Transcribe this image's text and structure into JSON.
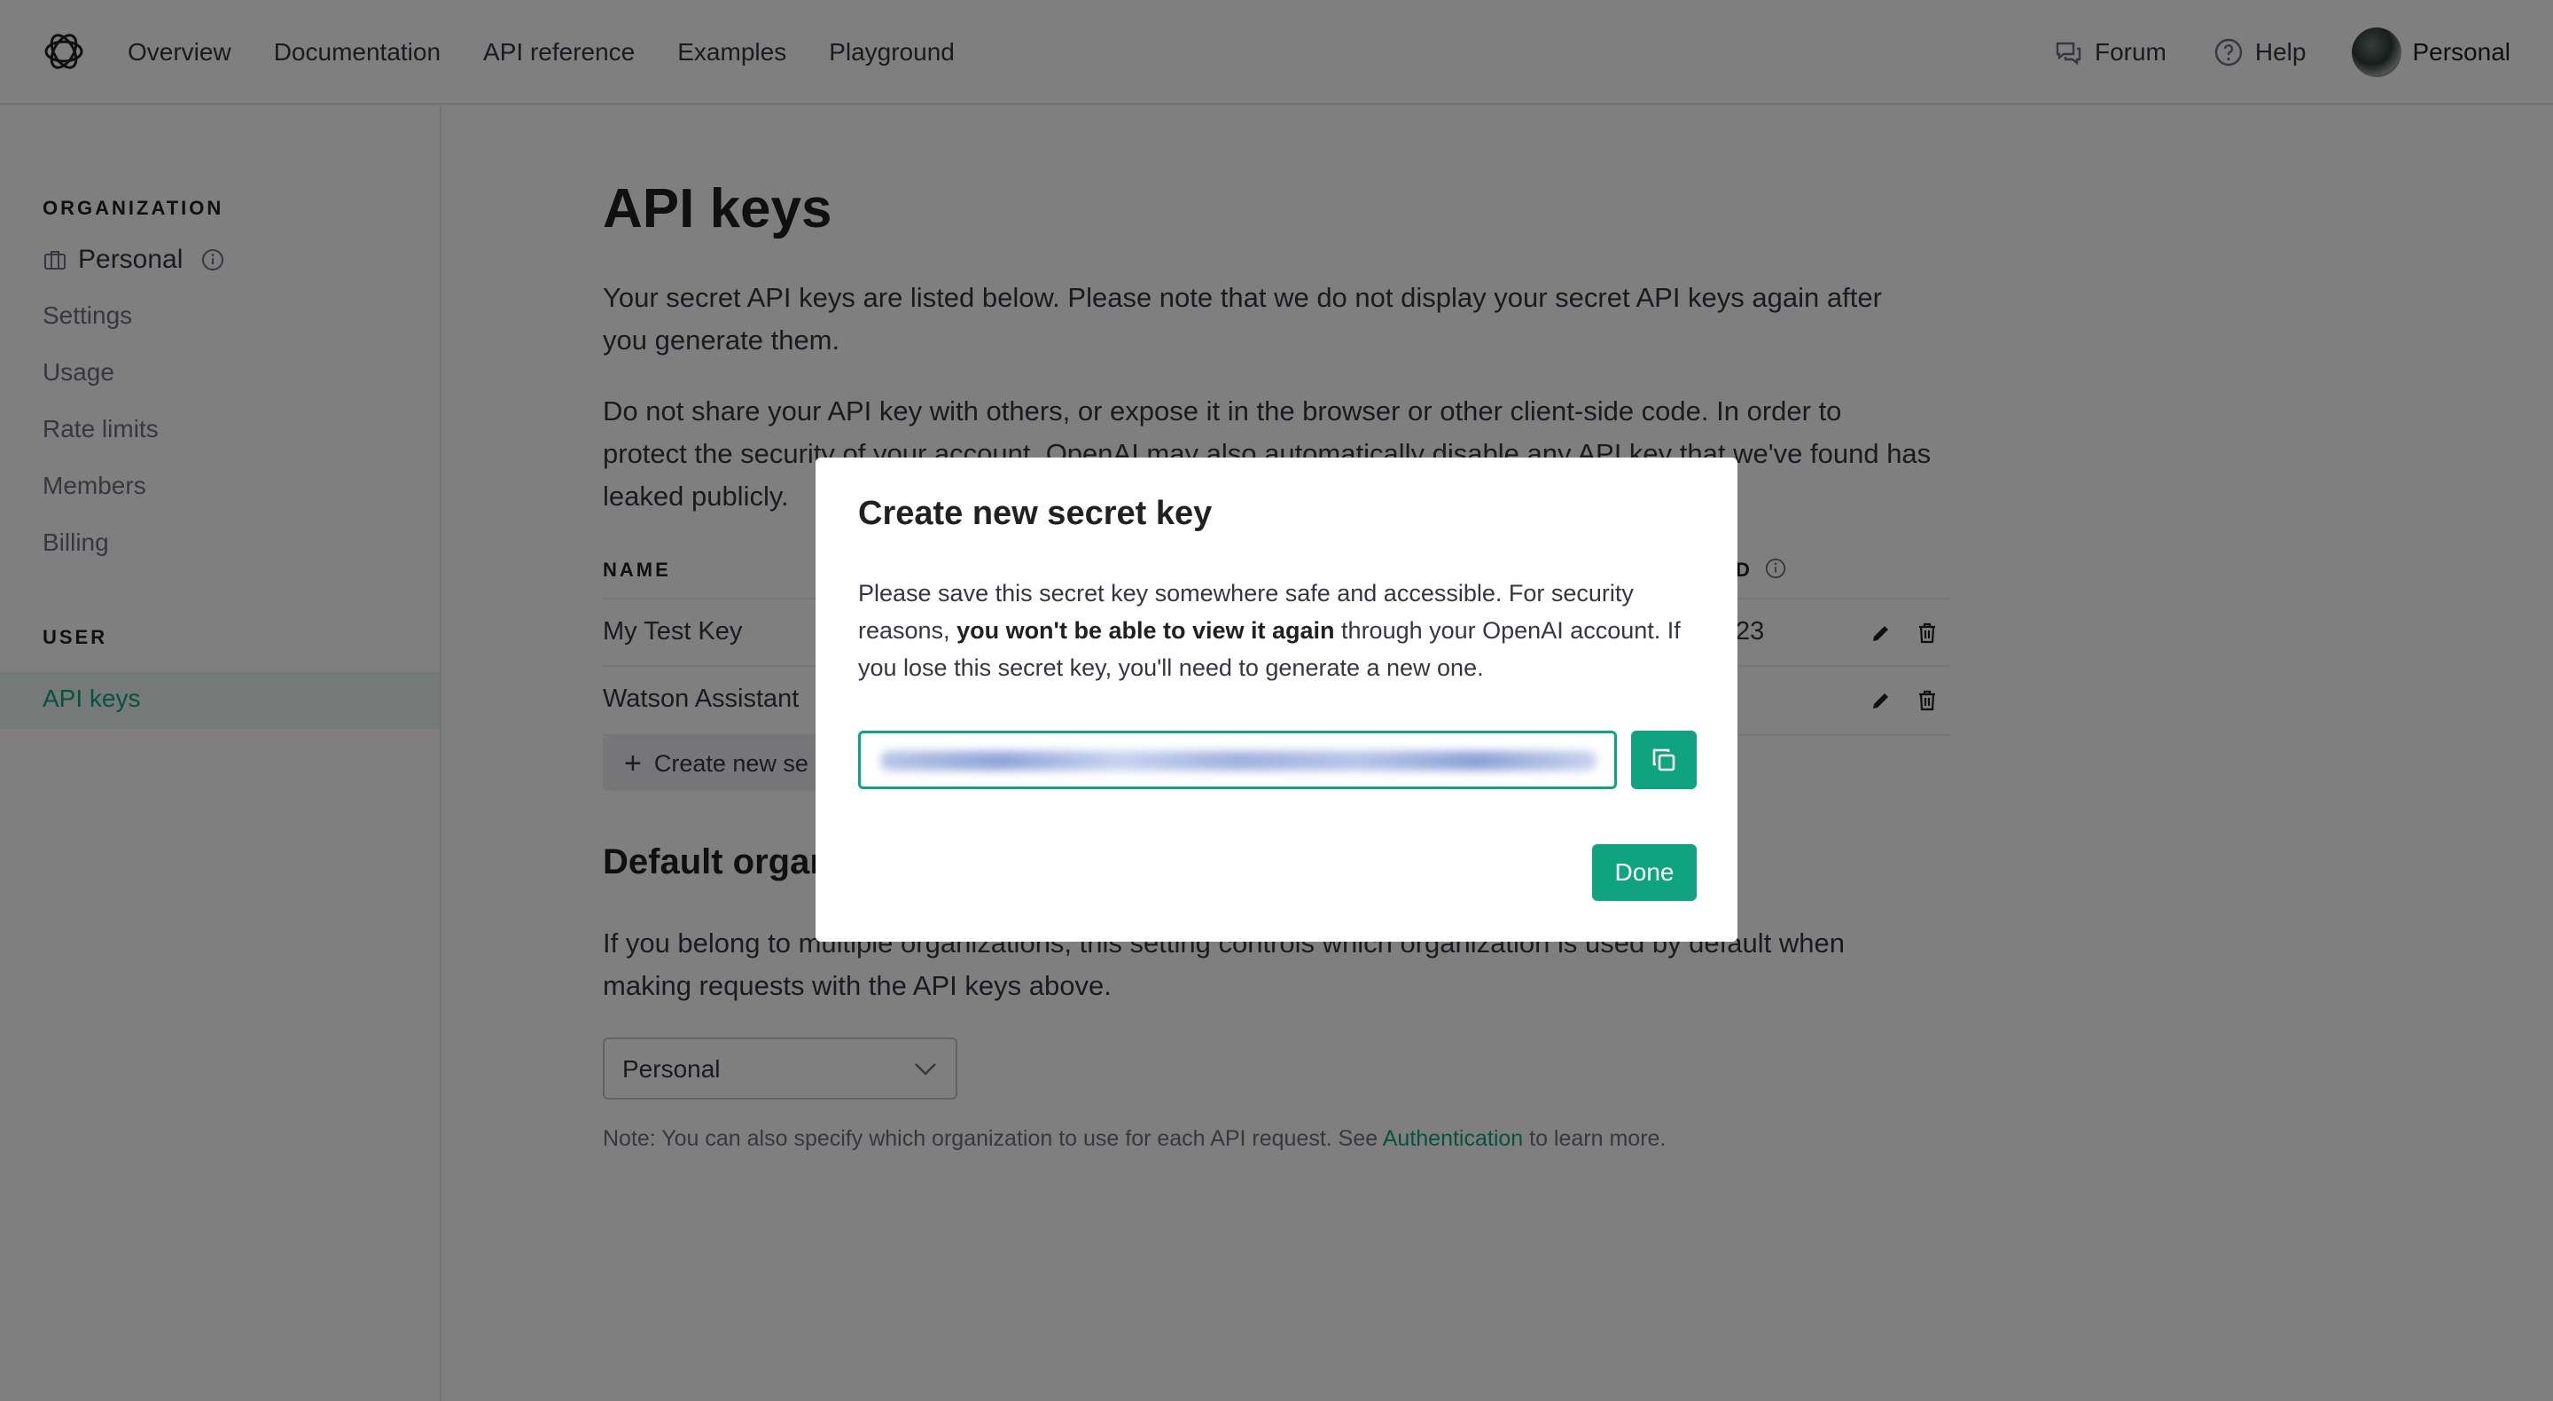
{
  "nav": {
    "links": [
      "Overview",
      "Documentation",
      "API reference",
      "Examples",
      "Playground"
    ],
    "forum": "Forum",
    "help": "Help",
    "account": "Personal"
  },
  "sidebar": {
    "org_heading": "ORGANIZATION",
    "org_name": "Personal",
    "org_items": [
      "Settings",
      "Usage",
      "Rate limits",
      "Members",
      "Billing"
    ],
    "user_heading": "USER",
    "active_item": "API keys"
  },
  "main": {
    "title": "API keys",
    "intro": "Your secret API keys are listed below. Please note that we do not display your secret API keys again after you generate them.",
    "warning": "Do not share your API key with others, or expose it in the browser or other client-side code. In order to protect the security of your account, OpenAI may also automatically disable any API key that we've found has leaked publicly.",
    "table": {
      "col_name": "NAME",
      "col_used": "D",
      "rows": [
        {
          "name": "My Test Key",
          "used": "23"
        },
        {
          "name": "Watson Assistant",
          "used": ""
        }
      ]
    },
    "create_label": "Create new se",
    "default_org_title": "Default organization",
    "default_org_desc": "If you belong to multiple organizations, this setting controls which organization is used by default when making requests with the API keys above.",
    "select_value": "Personal",
    "note_prefix": "Note: You can also specify which organization to use for each API request. See ",
    "note_link": "Authentication",
    "note_suffix": " to learn more."
  },
  "modal": {
    "title": "Create new secret key",
    "body_1": "Please save this secret key somewhere safe and accessible. For security reasons, ",
    "body_bold": "you won't be able to view it again",
    "body_2": " through your OpenAI account. If you lose this secret key, you'll need to generate a new one.",
    "done_label": "Done"
  },
  "colors": {
    "accent": "#10a37f",
    "overlay": "rgba(0,0,0,0.5)"
  }
}
